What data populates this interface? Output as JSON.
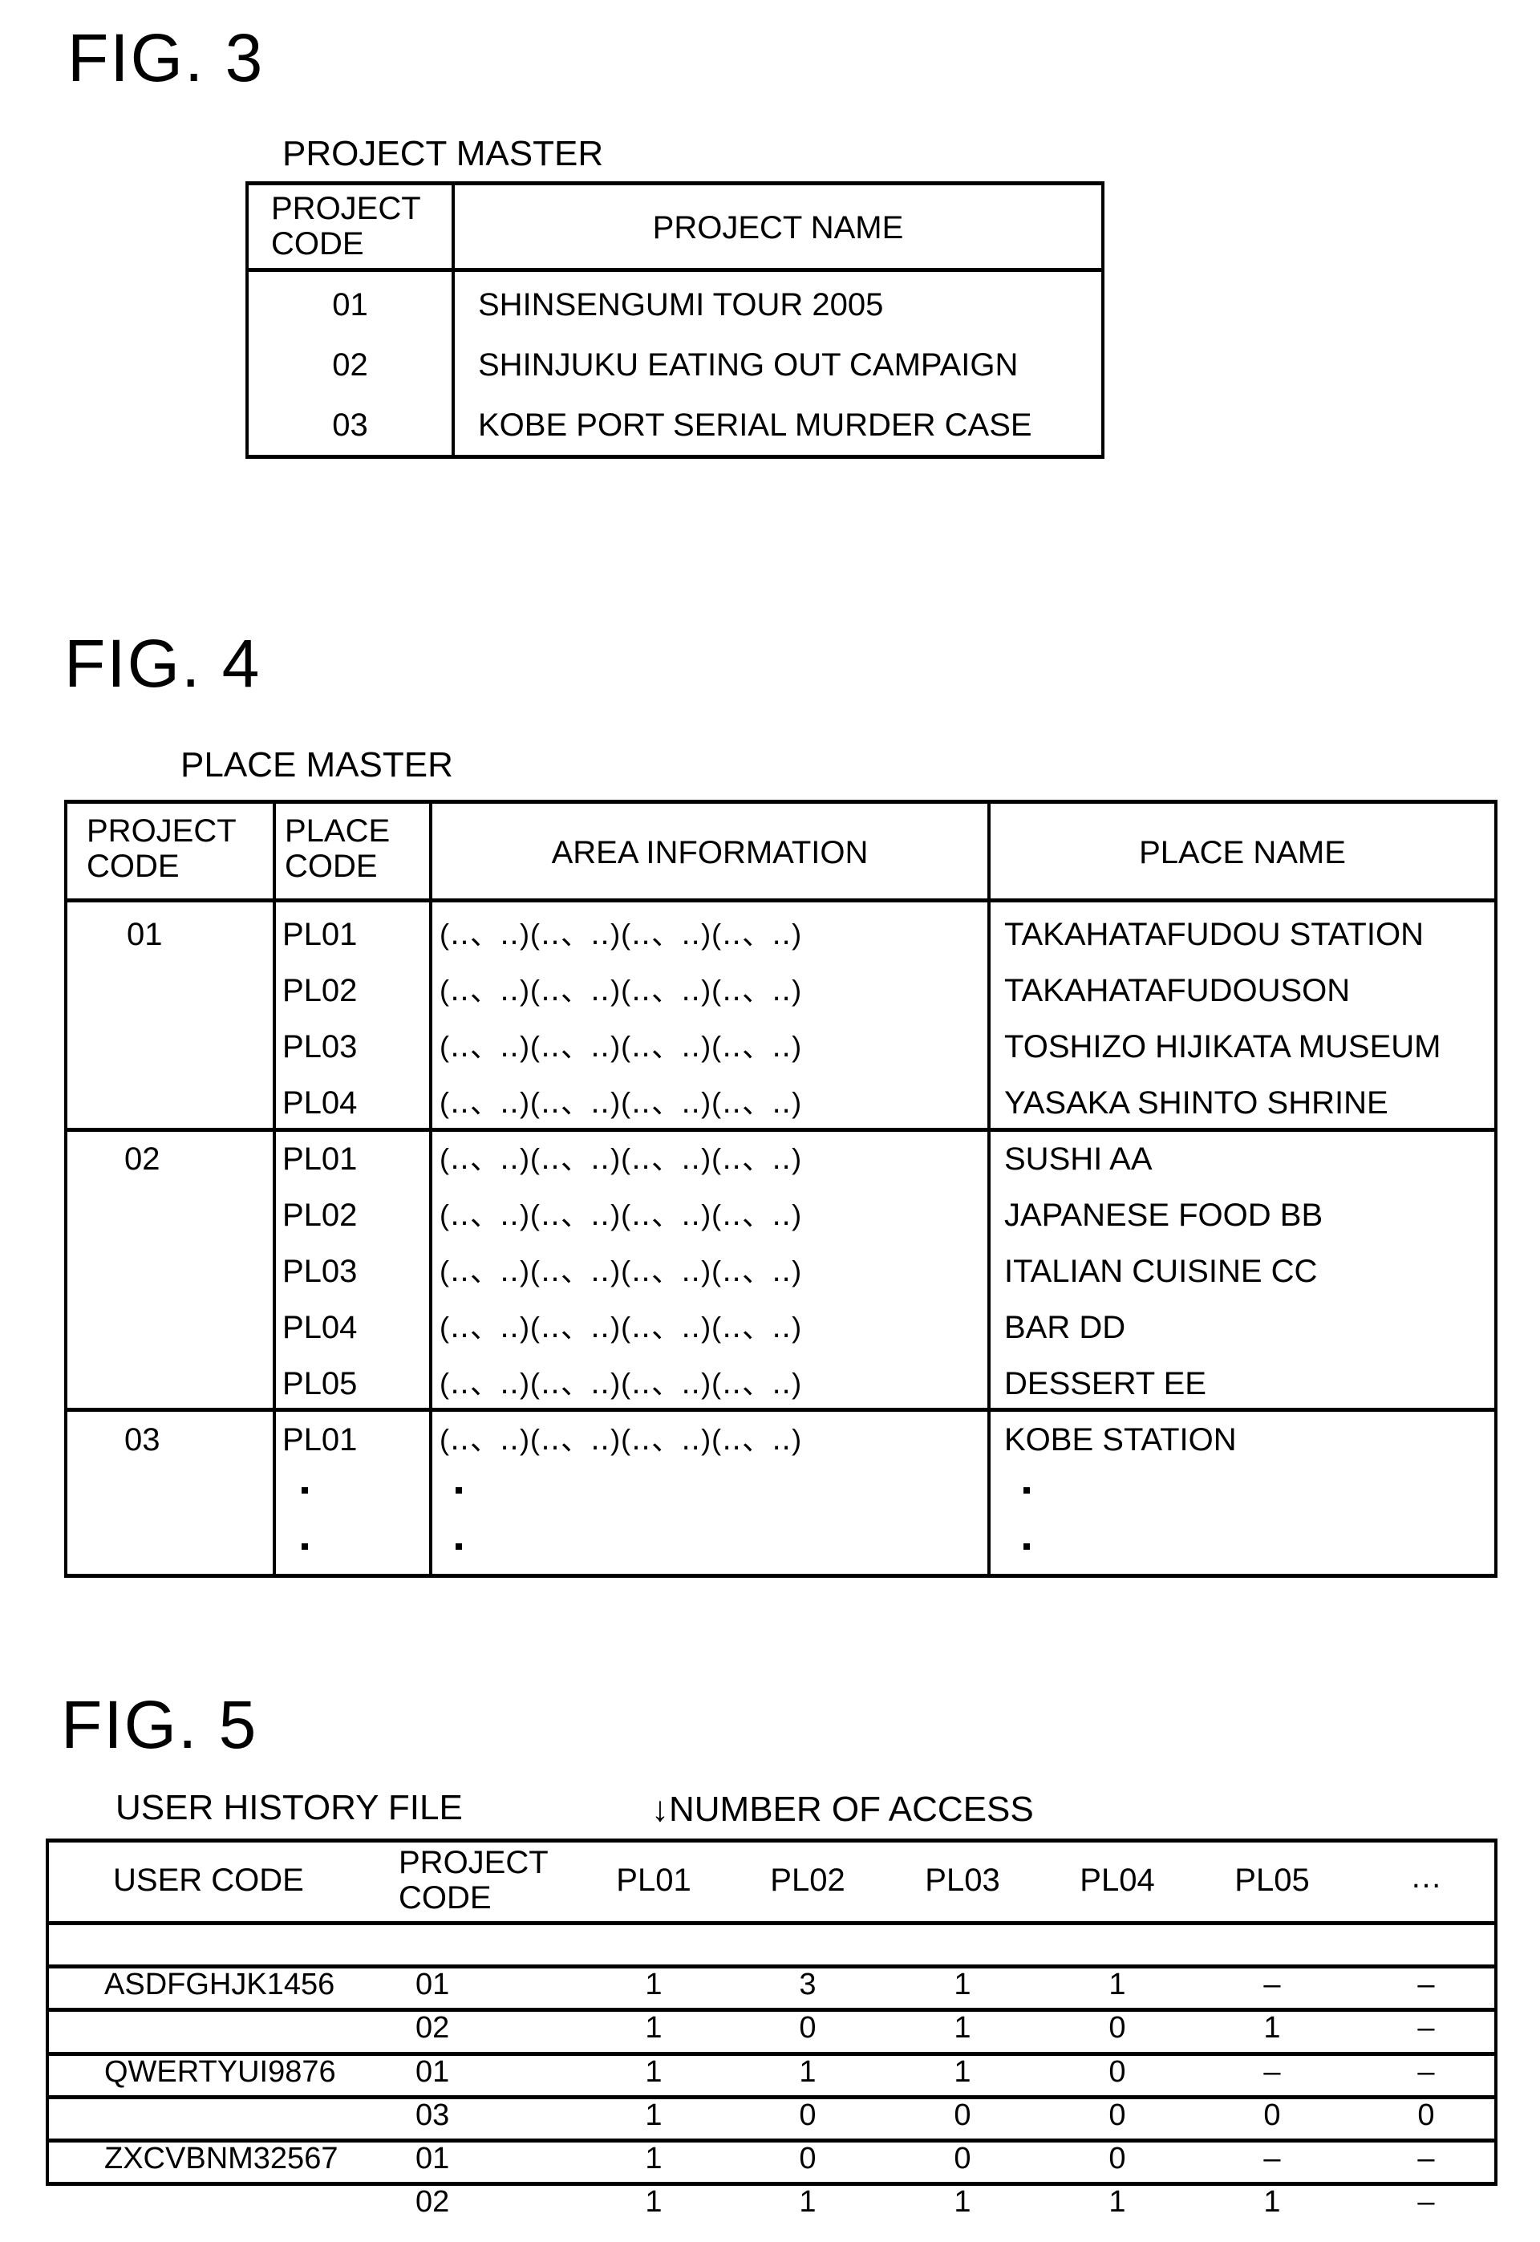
{
  "fig3": {
    "title": "FIG. 3",
    "caption": "PROJECT MASTER",
    "headers": {
      "project_code": [
        "PROJECT",
        "CODE"
      ],
      "project_name": "PROJECT NAME"
    },
    "rows": [
      {
        "code": "01",
        "name": "SHINSENGUMI TOUR 2005"
      },
      {
        "code": "02",
        "name": "SHINJUKU EATING OUT CAMPAIGN"
      },
      {
        "code": "03",
        "name": "KOBE PORT SERIAL MURDER CASE"
      }
    ]
  },
  "fig4": {
    "title": "FIG. 4",
    "caption": "PLACE MASTER",
    "headers": {
      "project_code": [
        "PROJECT",
        "CODE"
      ],
      "place_code": [
        "PLACE",
        "CODE"
      ],
      "area_information": "AREA INFORMATION",
      "place_name": "PLACE NAME"
    },
    "area_placeholder": "(‥、‥)(‥、‥)(‥、‥)(‥、‥)",
    "groups": [
      {
        "project_code": "01",
        "places": [
          {
            "code": "PL01",
            "name": "TAKAHATAFUDOU STATION"
          },
          {
            "code": "PL02",
            "name": "TAKAHATAFUDOUSON"
          },
          {
            "code": "PL03",
            "name": "TOSHIZO HIJIKATA MUSEUM"
          },
          {
            "code": "PL04",
            "name": "YASAKA SHINTO SHRINE"
          }
        ]
      },
      {
        "project_code": "02",
        "places": [
          {
            "code": "PL01",
            "name": "SUSHI AA"
          },
          {
            "code": "PL02",
            "name": "JAPANESE FOOD BB"
          },
          {
            "code": "PL03",
            "name": "ITALIAN CUISINE CC"
          },
          {
            "code": "PL04",
            "name": "BAR DD"
          },
          {
            "code": "PL05",
            "name": "DESSERT EE"
          }
        ]
      },
      {
        "project_code": "03",
        "places": [
          {
            "code": "PL01",
            "name": "KOBE STATION"
          }
        ],
        "continued": true
      }
    ]
  },
  "fig5": {
    "title": "FIG. 5",
    "caption": "USER HISTORY FILE",
    "annotation": "↓NUMBER OF ACCESS",
    "headers": {
      "user_code": "USER CODE",
      "project_code": [
        "PROJECT",
        "CODE"
      ],
      "places": [
        "PL01",
        "PL02",
        "PL03",
        "PL04",
        "PL05",
        "…"
      ]
    },
    "rows": [
      {
        "user": "ASDFGHJK1456",
        "project": "01",
        "values": [
          "1",
          "3",
          "1",
          "1",
          "–",
          "–"
        ]
      },
      {
        "user": "",
        "project": "02",
        "values": [
          "1",
          "0",
          "1",
          "0",
          "1",
          "–"
        ]
      },
      {
        "user": "QWERTYUI9876",
        "project": "01",
        "values": [
          "1",
          "1",
          "1",
          "0",
          "–",
          "–"
        ]
      },
      {
        "user": "",
        "project": "03",
        "values": [
          "1",
          "0",
          "0",
          "0",
          "0",
          "0"
        ]
      },
      {
        "user": "ZXCVBNM32567",
        "project": "01",
        "values": [
          "1",
          "0",
          "0",
          "0",
          "–",
          "–"
        ]
      },
      {
        "user": "",
        "project": "02",
        "values": [
          "1",
          "1",
          "1",
          "1",
          "1",
          "–"
        ]
      }
    ]
  }
}
